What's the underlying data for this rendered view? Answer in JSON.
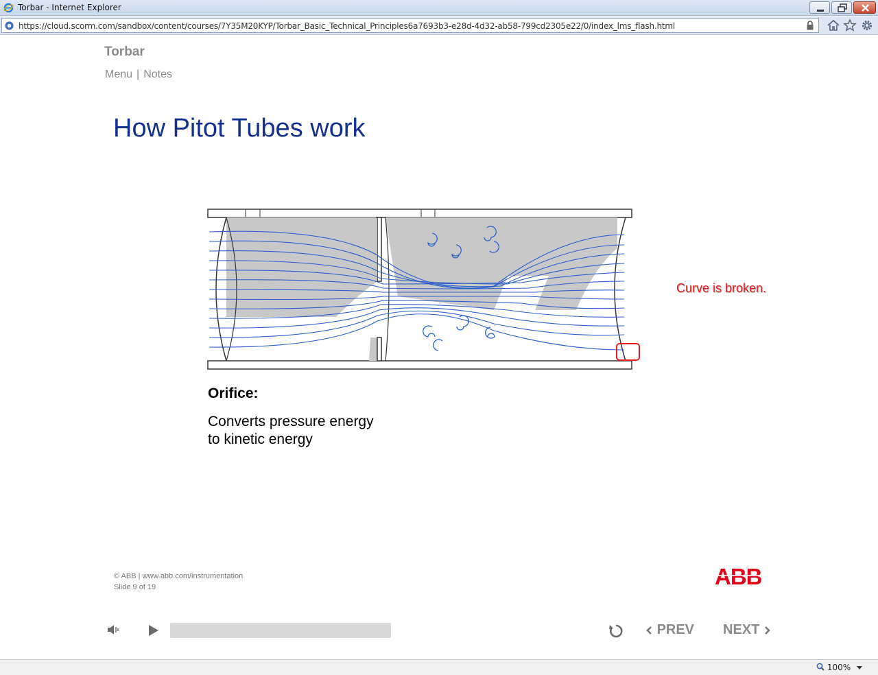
{
  "window": {
    "title": "Torbar - Internet Explorer",
    "url": "https://cloud.scorm.com/sandbox/content/courses/7Y35M20KYP/Torbar_Basic_Technical_Principles6a7693b3-e28d-4d32-ab58-799cd2305e22/0/index_lms_flash.html"
  },
  "course": {
    "title": "Torbar",
    "nav": {
      "menu": "Menu",
      "separator": "|",
      "notes": "Notes"
    }
  },
  "slide": {
    "title": "How Pitot Tubes work",
    "orifice_label": "Orifice:",
    "orifice_line1": "Converts pressure energy",
    "orifice_line2": "to kinetic energy",
    "annotation": "Curve is broken."
  },
  "footer": {
    "copyright": "© ABB | www.abb.com/instrumentation",
    "slide_counter": "Slide 9 of 19",
    "logo_text": "ABB"
  },
  "player": {
    "progress": 0.0,
    "prev_label": "PREV",
    "next_label": "NEXT"
  },
  "status": {
    "zoom": "100%"
  },
  "colors": {
    "title_blue": "#13308e",
    "flow_blue": "#2c5fc8",
    "annotation_red": "#e21e1e",
    "abb_red": "#e2001a"
  }
}
